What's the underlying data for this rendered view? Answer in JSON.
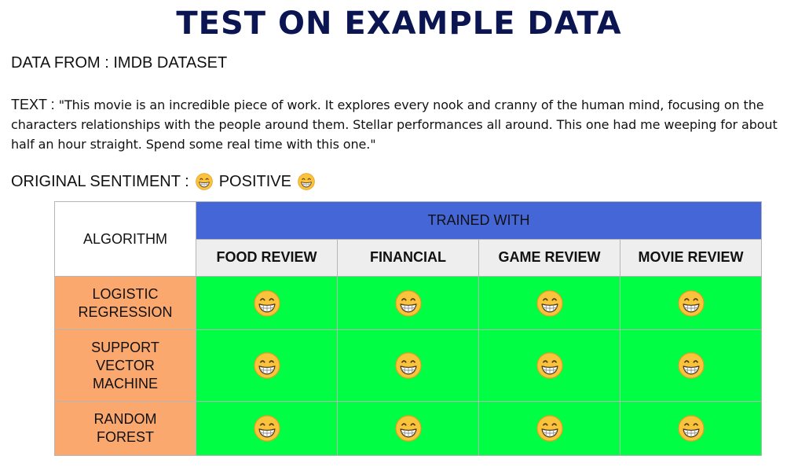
{
  "title": "TEST ON EXAMPLE DATA",
  "source": "DATA FROM : IMDB DATASET",
  "text_label": "TEXT : ",
  "review_text": "\"This movie is an incredible piece of work. It explores every nook and cranny of the human mind, focusing on the characters relationships with the people around them. Stellar performances all around. This one had me weeping for about half an hour straight. Spend some real time with this one.\"",
  "original_sentiment": {
    "label": "ORIGINAL SENTIMENT : ",
    "value": "POSITIVE",
    "icon": "grinning-face-icon"
  },
  "table": {
    "algorithm_header": "ALGORITHM",
    "trained_with_header": "TRAINED WITH",
    "columns": [
      "FOOD REVIEW",
      "FINANCIAL",
      "GAME REVIEW",
      "MOVIE REVIEW"
    ],
    "rows": [
      {
        "algorithm_lines": [
          "LOGISTIC",
          "REGRESSION"
        ],
        "results": [
          "grinning-face-icon",
          "grinning-face-icon",
          "grinning-face-icon",
          "grinning-face-icon"
        ]
      },
      {
        "algorithm_lines": [
          "SUPPORT",
          "VECTOR",
          "MACHINE"
        ],
        "results": [
          "grinning-face-icon",
          "grinning-face-icon",
          "grinning-face-icon",
          "grinning-face-icon"
        ]
      },
      {
        "algorithm_lines": [
          "RANDOM",
          "FOREST"
        ],
        "results": [
          "grinning-face-icon",
          "grinning-face-icon",
          "grinning-face-icon",
          "grinning-face-icon"
        ]
      }
    ]
  },
  "colors": {
    "title": "#0b1552",
    "trained_header_bg": "#4566d6",
    "column_header_bg": "#eeeeee",
    "algorithm_bg": "#fba86f",
    "result_bg": "#00ff44"
  }
}
